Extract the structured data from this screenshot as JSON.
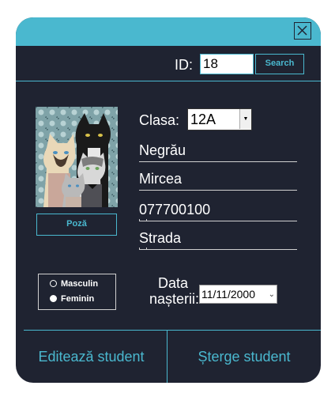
{
  "header": {
    "close_icon": "close-icon"
  },
  "search": {
    "id_label": "ID:",
    "id_value": "18",
    "search_label": "Search"
  },
  "photo": {
    "button_label": "Poză"
  },
  "form": {
    "clasa_label": "Clasa:",
    "clasa_value": "12A",
    "last_name": "Negrău",
    "first_name": "Mircea",
    "phone": "077700100",
    "street": "Strada"
  },
  "gender": {
    "options": [
      {
        "label": "Masculin",
        "selected": false
      },
      {
        "label": "Feminin",
        "selected": true
      }
    ]
  },
  "birth": {
    "label_line1": "Data",
    "label_line2": "nașterii:",
    "value": "11/11/2000"
  },
  "footer": {
    "edit_label": "Editează student",
    "delete_label": "Șterge student"
  },
  "colors": {
    "accent": "#4ab8cf",
    "background": "#1f2331",
    "page": "#ffffff"
  }
}
